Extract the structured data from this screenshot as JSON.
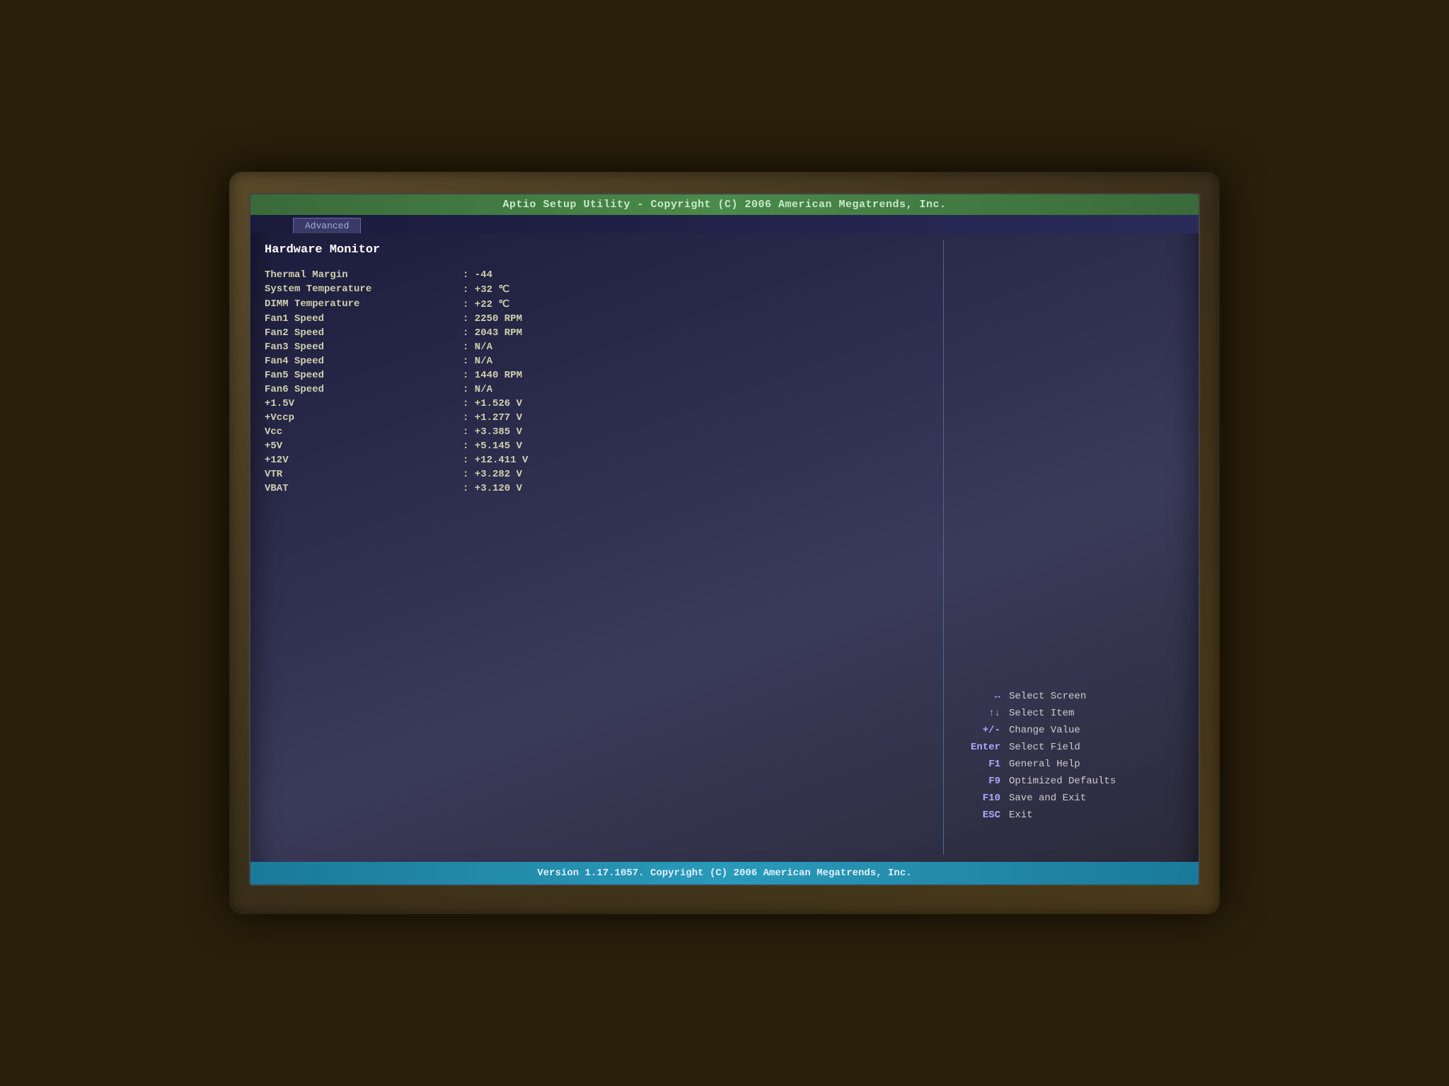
{
  "header": {
    "title": "Aptio Setup Utility - Copyright (C) 2006 American Megatrends, Inc.",
    "tab": "Advanced"
  },
  "section": {
    "title": "Hardware Monitor"
  },
  "rows": [
    {
      "label": "Thermal Margin",
      "value": ": -44"
    },
    {
      "label": "System Temperature",
      "value": ": +32 ℃"
    },
    {
      "label": "DIMM Temperature",
      "value": ": +22 ℃"
    },
    {
      "label": "Fan1 Speed",
      "value": ": 2250 RPM"
    },
    {
      "label": "Fan2 Speed",
      "value": ": 2043 RPM"
    },
    {
      "label": "Fan3 Speed",
      "value": ": N/A"
    },
    {
      "label": "Fan4 Speed",
      "value": ": N/A"
    },
    {
      "label": "Fan5 Speed",
      "value": ": 1440 RPM"
    },
    {
      "label": "Fan6 Speed",
      "value": ": N/A"
    },
    {
      "label": "+1.5V",
      "value": ": +1.526 V"
    },
    {
      "label": "+Vccp",
      "value": ": +1.277 V"
    },
    {
      "label": "Vcc",
      "value": ": +3.385 V"
    },
    {
      "label": "+5V",
      "value": ": +5.145 V"
    },
    {
      "label": "+12V",
      "value": ": +12.411 V"
    },
    {
      "label": "VTR",
      "value": ": +3.282 V"
    },
    {
      "label": "VBAT",
      "value": ": +3.120 V"
    }
  ],
  "keyhelp": [
    {
      "key": "↔",
      "desc": "Select Screen"
    },
    {
      "key": "↑↓",
      "desc": "Select Item"
    },
    {
      "key": "+/-",
      "desc": "Change Value"
    },
    {
      "key": "Enter",
      "desc": "Select Field"
    },
    {
      "key": "F1",
      "desc": "General Help"
    },
    {
      "key": "F9",
      "desc": "Optimized Defaults"
    },
    {
      "key": "F10",
      "desc": "Save and Exit"
    },
    {
      "key": "ESC",
      "desc": "Exit"
    }
  ],
  "footer": {
    "text": "Version 1.17.1057. Copyright (C) 2006 American Megatrends, Inc."
  }
}
